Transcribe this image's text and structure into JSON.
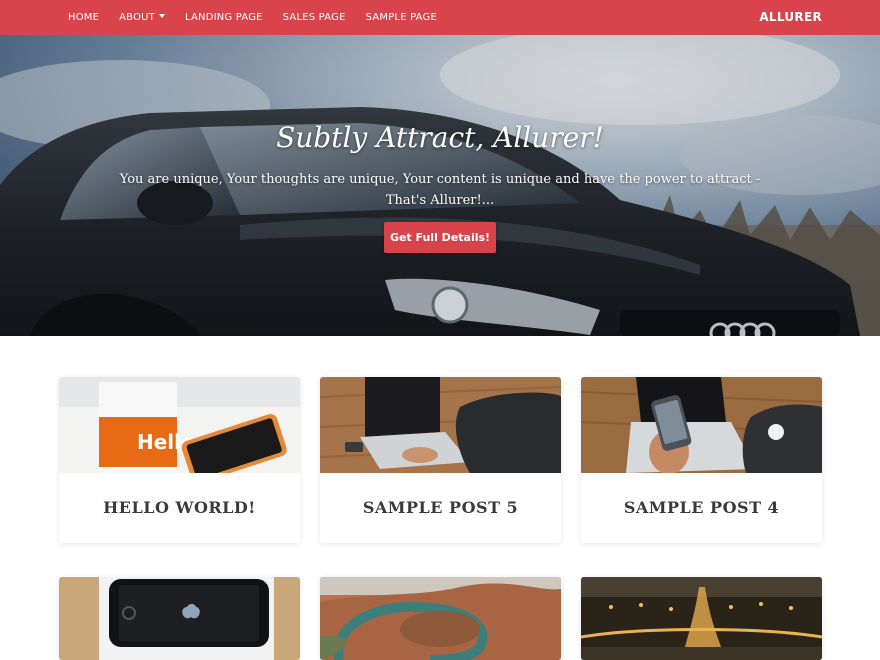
{
  "nav": {
    "items": [
      {
        "label": "HOME",
        "has_dropdown": false
      },
      {
        "label": "ABOUT",
        "has_dropdown": true
      },
      {
        "label": "LANDING PAGE",
        "has_dropdown": false
      },
      {
        "label": "SALES PAGE",
        "has_dropdown": false
      },
      {
        "label": "SAMPLE PAGE",
        "has_dropdown": false
      }
    ],
    "brand": "ALLURER",
    "bg_color": "#d9434c"
  },
  "hero": {
    "title": "Subtly Attract, Allurer!",
    "text": "You are unique, Your thoughts are unique, Your content is unique and have the power to attract - That's Allurer!...",
    "button_label": "Get Full Details!",
    "button_color": "#d9434c",
    "background_subject": "dark car under cloudy sky"
  },
  "posts": [
    {
      "title": "HELLO WORLD!",
      "image_subject": "hello mug and phone"
    },
    {
      "title": "SAMPLE POST 5",
      "image_subject": "laptop on wooden desk"
    },
    {
      "title": "SAMPLE POST 4",
      "image_subject": "phone over laptop"
    },
    {
      "title": "",
      "image_subject": "iphone in box"
    },
    {
      "title": "",
      "image_subject": "canyon river bend"
    },
    {
      "title": "",
      "image_subject": "city lights at night"
    }
  ]
}
